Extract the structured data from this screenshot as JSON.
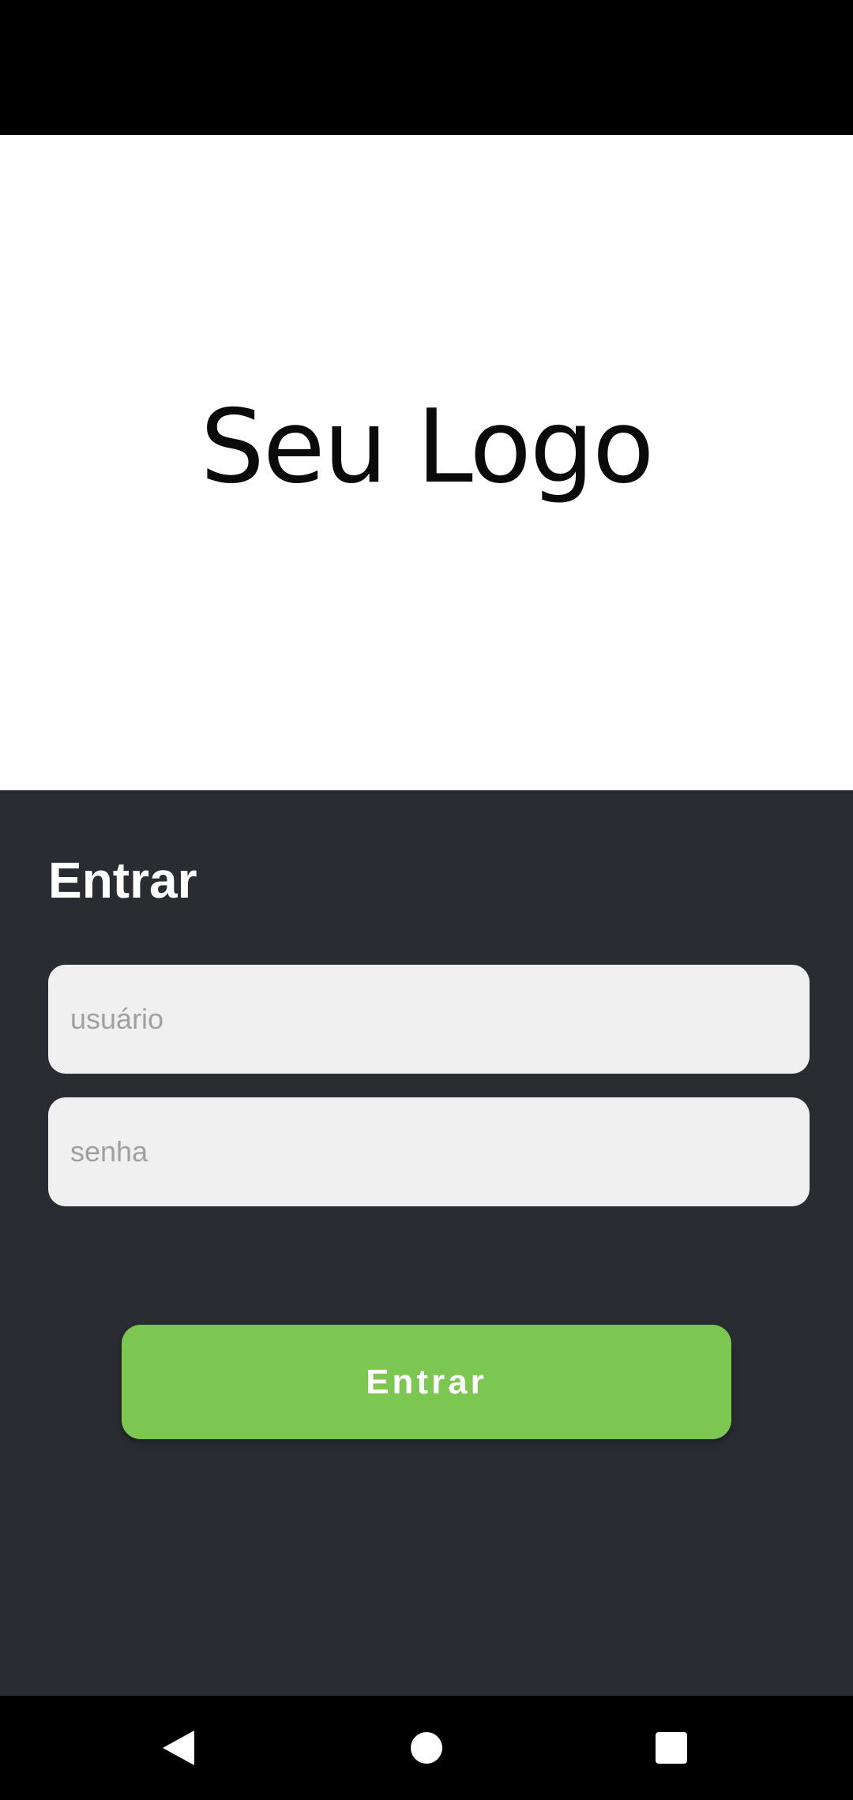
{
  "logo": {
    "text": "Seu Logo"
  },
  "login": {
    "title": "Entrar",
    "username_placeholder": "usuário",
    "username_value": "",
    "password_placeholder": "senha",
    "password_value": "",
    "submit_label": "Entrar"
  },
  "navigation": {
    "back_icon": "back-triangle-icon",
    "home_icon": "home-circle-icon",
    "recents_icon": "recents-square-icon"
  },
  "colors": {
    "panel_background": "#292c31",
    "input_background": "#f0f0f0",
    "button_accent": "#7cc652",
    "logo_background": "#ffffff",
    "system_bars": "#000000"
  }
}
